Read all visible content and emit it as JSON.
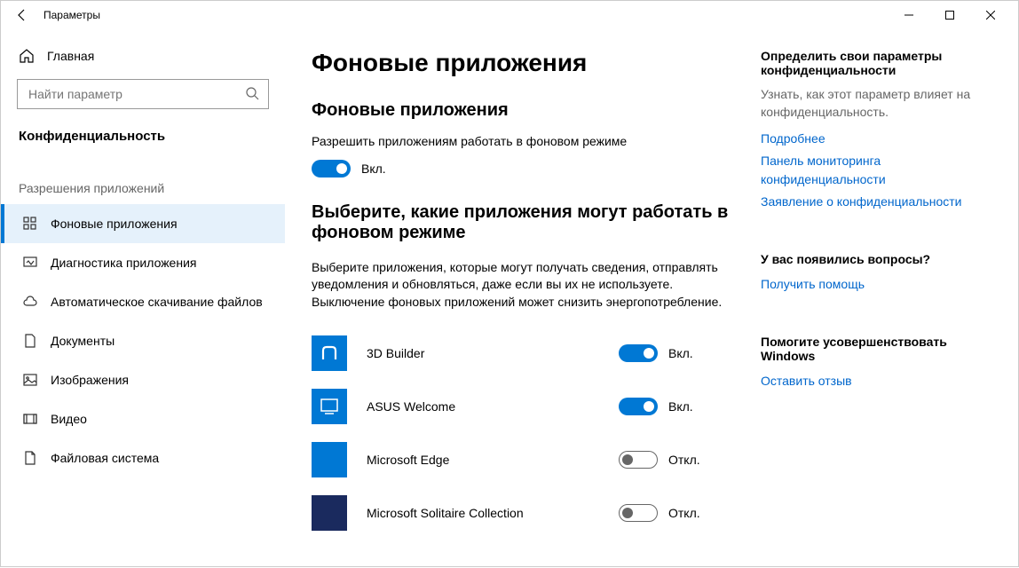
{
  "window": {
    "title": "Параметры"
  },
  "sidebar": {
    "home": "Главная",
    "search_placeholder": "Найти параметр",
    "category": "Конфиденциальность",
    "section_label": "Разрешения приложений",
    "items": [
      {
        "label": "Фоновые приложения",
        "icon": "apps",
        "active": true
      },
      {
        "label": "Диагностика приложения",
        "icon": "diag",
        "active": false
      },
      {
        "label": "Автоматическое скачивание файлов",
        "icon": "cloud",
        "active": false
      },
      {
        "label": "Документы",
        "icon": "doc",
        "active": false
      },
      {
        "label": "Изображения",
        "icon": "image",
        "active": false
      },
      {
        "label": "Видео",
        "icon": "video",
        "active": false
      },
      {
        "label": "Файловая система",
        "icon": "file",
        "active": false
      }
    ]
  },
  "content": {
    "page_title": "Фоновые приложения",
    "section1_title": "Фоновые приложения",
    "section1_desc": "Разрешить приложениям работать в фоновом режиме",
    "master_on": true,
    "on_label": "Вкл.",
    "off_label": "Откл.",
    "section2_title": "Выберите, какие приложения могут работать в фоновом режиме",
    "section2_desc": "Выберите приложения, которые могут получать сведения, отправлять уведомления и обновляться, даже если вы их не используете. Выключение фоновых приложений может снизить энергопотребление.",
    "apps": [
      {
        "name": "3D Builder",
        "on": true,
        "color": "#0078d4"
      },
      {
        "name": "ASUS Welcome",
        "on": true,
        "color": "#0078d4"
      },
      {
        "name": "Microsoft Edge",
        "on": false,
        "color": "#0078d4"
      },
      {
        "name": "Microsoft Solitaire Collection",
        "on": false,
        "color": "#1a2a5e"
      }
    ]
  },
  "related": {
    "block1": {
      "title": "Определить свои параметры конфиденциальности",
      "subtext": "Узнать, как этот параметр влияет на конфиденциальность.",
      "links": [
        "Подробнее",
        "Панель мониторинга конфиденциальности",
        "Заявление о конфиденциальности"
      ]
    },
    "block2": {
      "title": "У вас появились вопросы?",
      "links": [
        "Получить помощь"
      ]
    },
    "block3": {
      "title": "Помогите усовершенствовать Windows",
      "links": [
        "Оставить отзыв"
      ]
    }
  }
}
